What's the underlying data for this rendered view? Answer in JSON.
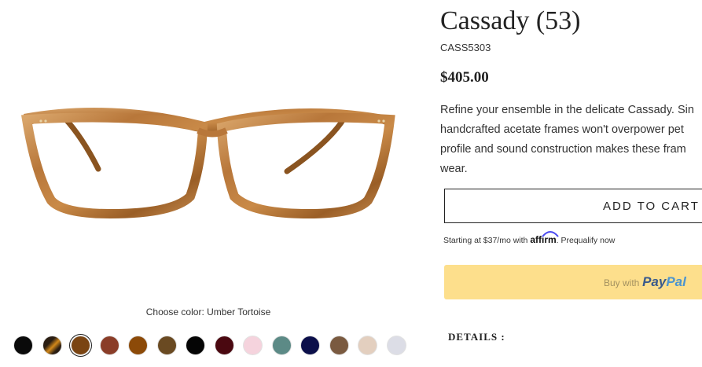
{
  "product": {
    "title": "Cassady (53)",
    "sku": "CASS5303",
    "price": "$405.00",
    "description_lines": [
      "Refine your ensemble in the delicate Cassady.  Sin",
      "handcrafted acetate frames won't overpower pet",
      "profile and sound construction makes these fram",
      "wear."
    ]
  },
  "color_picker": {
    "label": "Choose color: Umber Tortoise",
    "selected_index": 2,
    "swatches": [
      {
        "color": "#0a0a0a"
      },
      {
        "color": "#2a1d12",
        "accent": "#d2881a"
      },
      {
        "color": "#7a4412"
      },
      {
        "color": "#8a3d28"
      },
      {
        "color": "#8c4a08"
      },
      {
        "color": "#6a4a22"
      },
      {
        "color": "#050505"
      },
      {
        "color": "#4a0810"
      },
      {
        "color": "#f5d3dd"
      },
      {
        "color": "#5c8a86"
      },
      {
        "color": "#0b0f4a"
      },
      {
        "color": "#7a5a40"
      },
      {
        "color": "#e3cfbf"
      },
      {
        "color": "#dcdde6"
      }
    ]
  },
  "actions": {
    "add_to_cart_label": "ADD TO CART",
    "affirm_prefix": "Starting at $37/mo with",
    "affirm_brand": "affirm",
    "affirm_suffix": ". Prequalify now",
    "paypal_prefix": "Buy with",
    "paypal_brand_a": "Pay",
    "paypal_brand_b": "Pal"
  },
  "details": {
    "heading": "DETAILS :"
  },
  "colors": {
    "frame": "#b8773a",
    "frame_dark": "#8a5420",
    "frame_light": "#d9a56a",
    "paypal_bg": "#fddf8c",
    "affirm_arc": "#4a4af0"
  }
}
